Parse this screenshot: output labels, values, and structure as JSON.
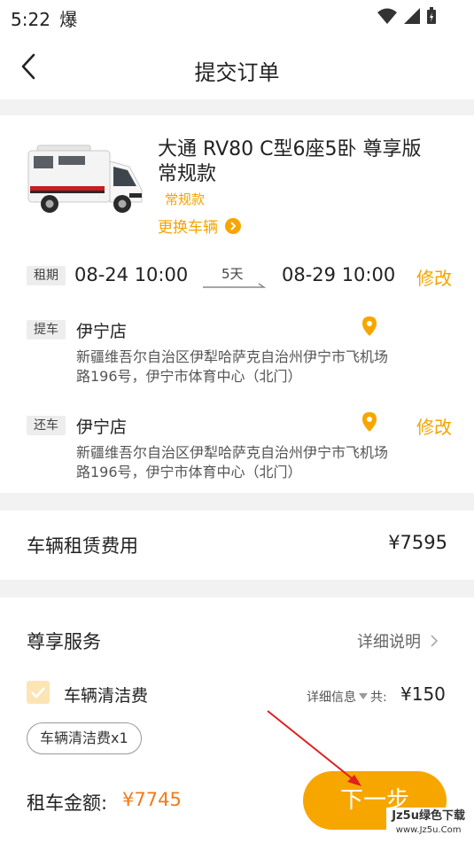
{
  "status": {
    "time": "5:22",
    "notif": "爆"
  },
  "nav": {
    "title": "提交订单"
  },
  "vehicle": {
    "name_line1": "大通  RV80  C型6座5卧  尊享版",
    "name_line2": "常规款",
    "badge": "常规款",
    "change_label": "更换车辆"
  },
  "rental": {
    "period_tag": "租期",
    "start": "08-24 10:00",
    "duration": "5天",
    "end": "08-29 10:00",
    "modify": "修改"
  },
  "pickup": {
    "tag": "提车",
    "store": "伊宁店",
    "address": "新疆维吾尔自治区伊犁哈萨克自治州伊宁市飞机场路196号，伊宁市体育中心（北门）"
  },
  "return": {
    "tag": "还车",
    "store": "伊宁店",
    "address": "新疆维吾尔自治区伊犁哈萨克自治州伊宁市飞机场路196号，伊宁市体育中心（北门）",
    "modify": "修改"
  },
  "fee": {
    "label": "车辆租赁费用",
    "amount": "¥7595"
  },
  "service": {
    "title": "尊享服务",
    "detail_link": "详细说明",
    "item_label": "车辆清洁费",
    "item_info": "详细信息",
    "item_total_prefix": "共:",
    "item_total": "¥150",
    "chip": "车辆清洁费x1"
  },
  "footer": {
    "total_label": "租车金额:",
    "total_amount": "¥7745",
    "next_button": "下一步"
  },
  "watermark": {
    "line1": "Jz5u绿色下载",
    "line2": "www.Jz5u.Com"
  },
  "colors": {
    "accent": "#f7a600",
    "price": "#f07a1a"
  }
}
